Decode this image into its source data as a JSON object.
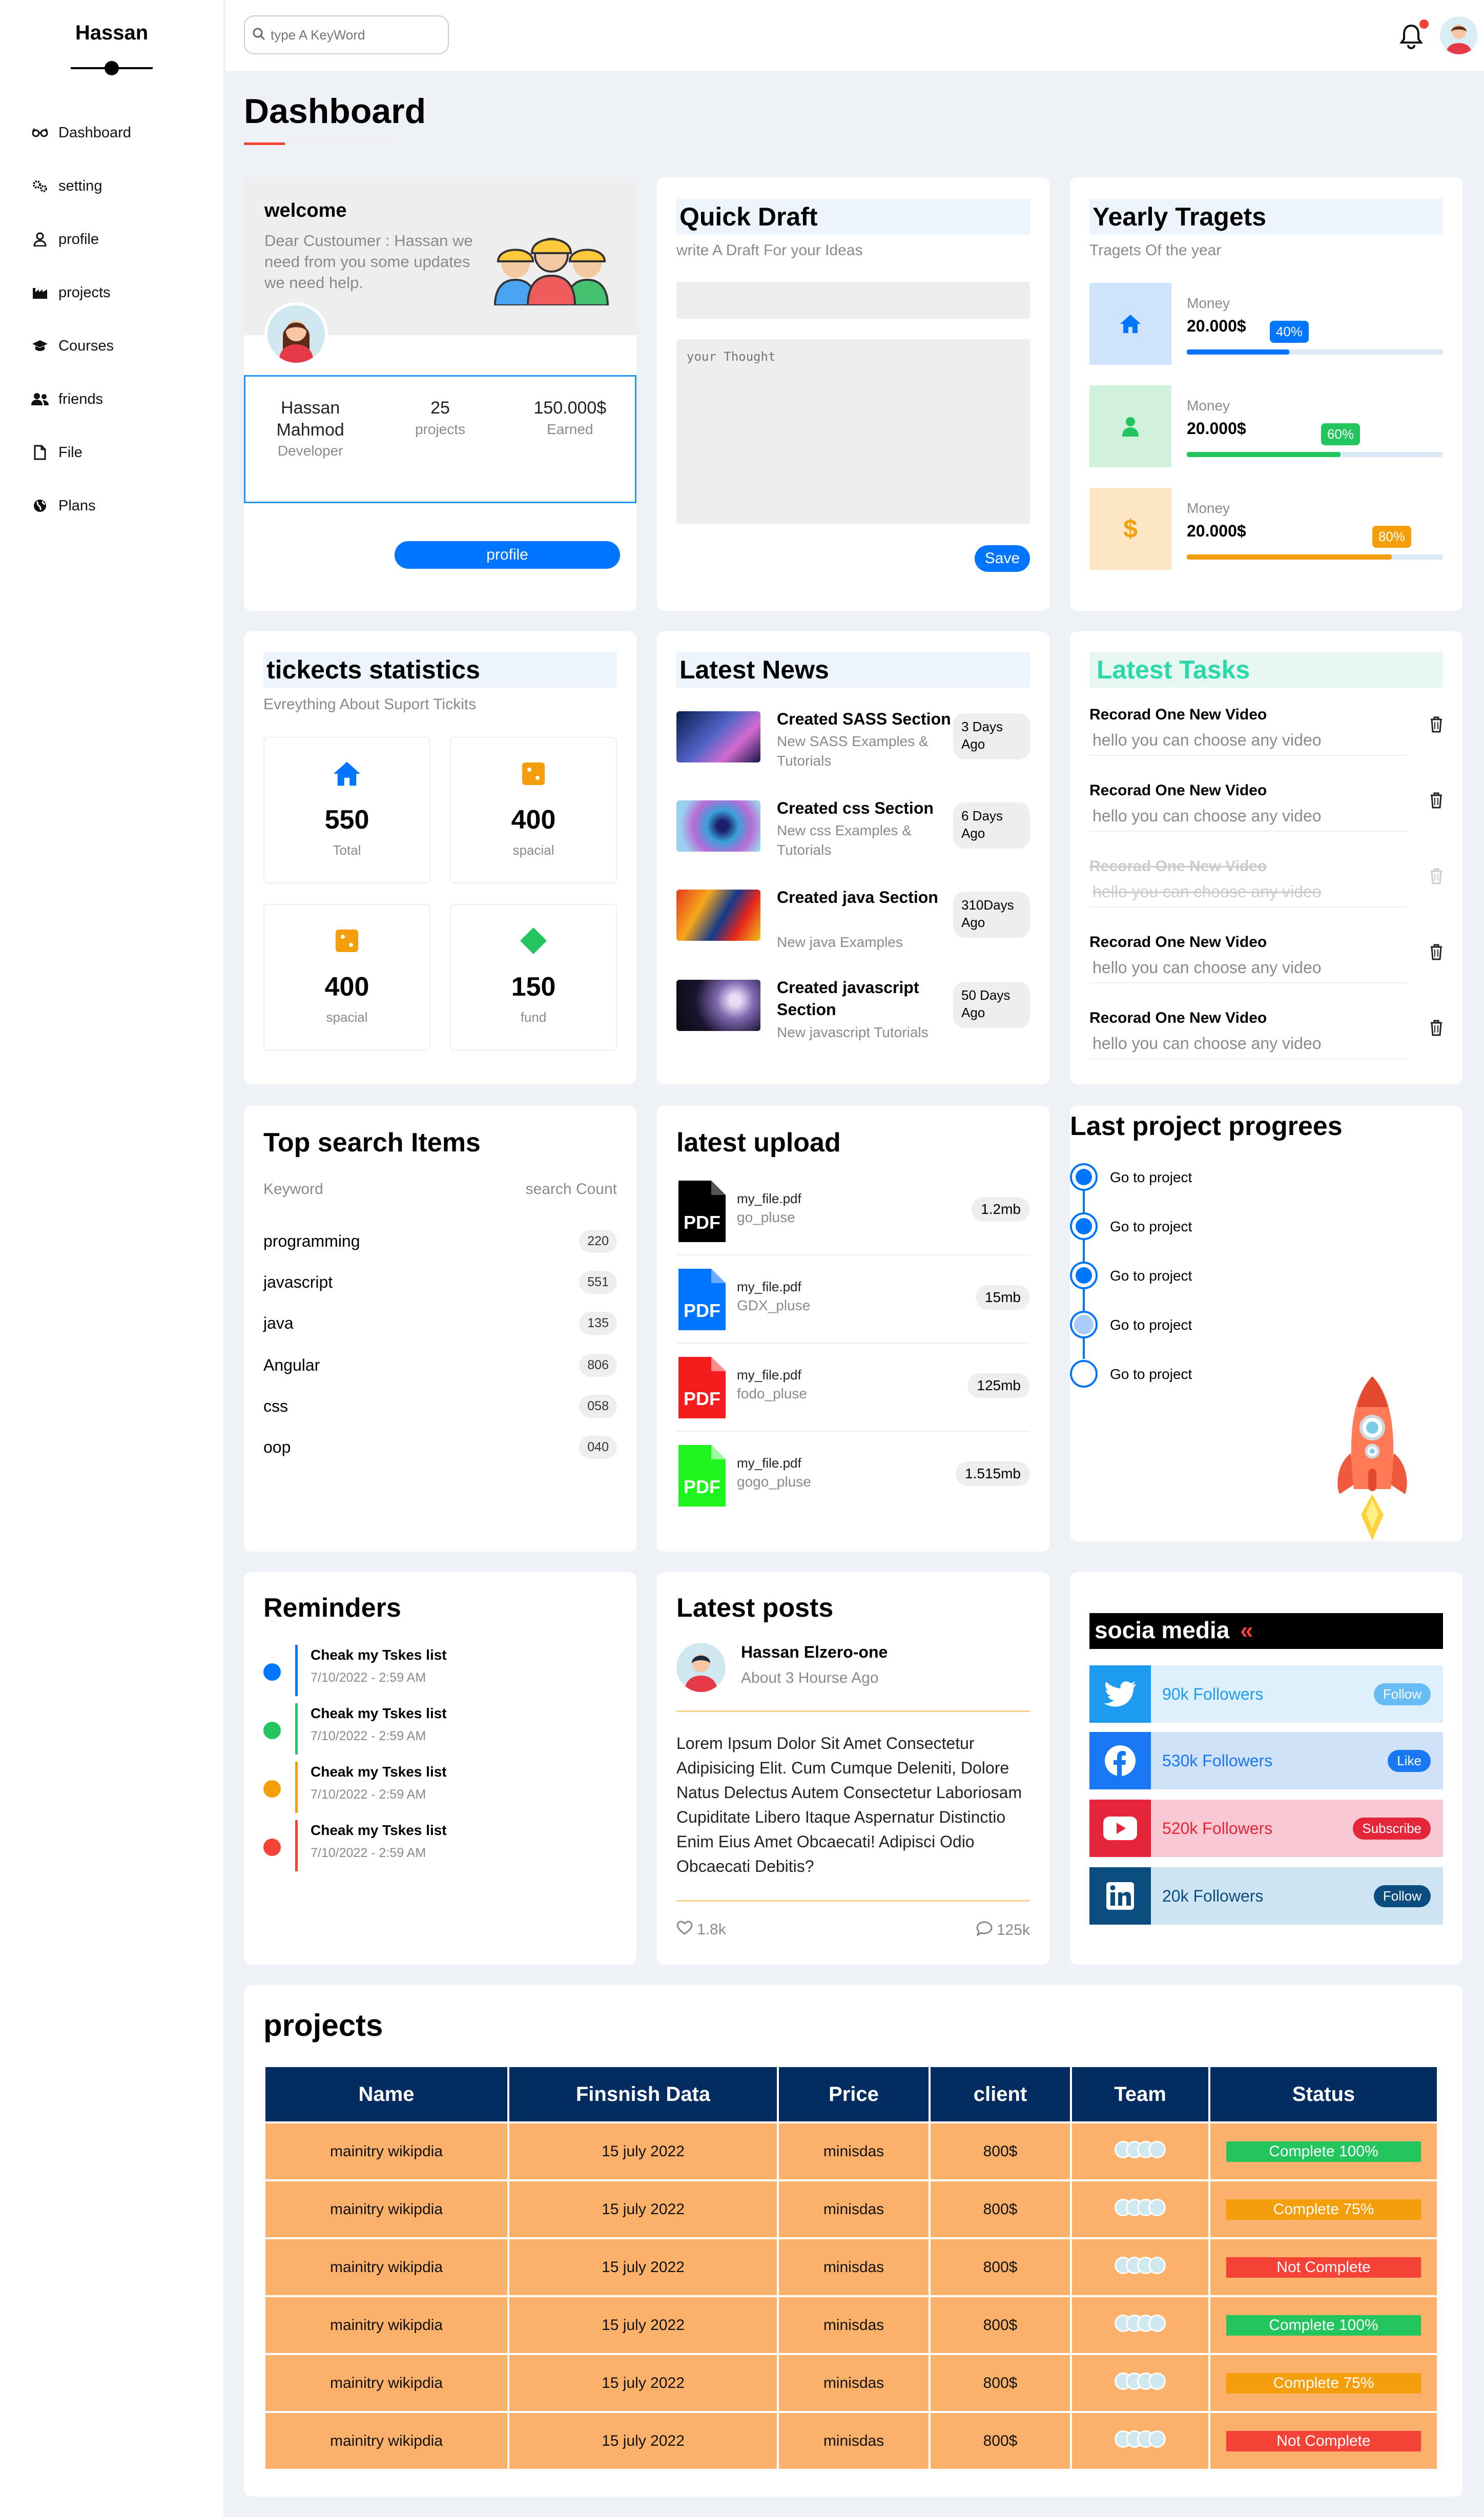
{
  "sidebar": {
    "brand": "Hassan",
    "items": [
      {
        "label": "Dashboard",
        "icon": "glasses-icon"
      },
      {
        "label": "setting",
        "icon": "gears-icon"
      },
      {
        "label": "profile",
        "icon": "user-icon"
      },
      {
        "label": "projects",
        "icon": "industry-icon"
      },
      {
        "label": "Courses",
        "icon": "graduation-cap-icon"
      },
      {
        "label": "friends",
        "icon": "users-icon"
      },
      {
        "label": "File",
        "icon": "file-icon"
      },
      {
        "label": "Plans",
        "icon": "globe-icon"
      }
    ]
  },
  "header": {
    "search_placeholder": "type A KeyWord"
  },
  "page_title": "Dashboard",
  "welcome": {
    "title": "welcome",
    "text": "Dear Custoumer : Hassan we need from you some updates we need help.",
    "stats": [
      {
        "value": "Hassan Mahmod",
        "label": "Developer"
      },
      {
        "value": "25",
        "label": "projects"
      },
      {
        "value": "150.000$",
        "label": "Earned"
      }
    ],
    "button": "profile"
  },
  "quick_draft": {
    "title": "Quick Draft",
    "subtitle": "write A Draft For your Ideas",
    "textarea_placeholder": "your Thought",
    "save": "Save"
  },
  "targets": {
    "title": "Yearly Tragets",
    "subtitle": "Tragets Of the year",
    "items": [
      {
        "label": "Money",
        "value": "20.000$",
        "percent": 40,
        "percent_label": "40%",
        "color": "#0075ff",
        "bg": "#cfe3fb",
        "icon": "home-icon"
      },
      {
        "label": "Money",
        "value": "20.000$",
        "percent": 60,
        "percent_label": "60%",
        "color": "#22c55e",
        "bg": "#d1f1dd",
        "icon": "user-icon"
      },
      {
        "label": "Money",
        "value": "20.000$",
        "percent": 80,
        "percent_label": "80%",
        "color": "#f59e0b",
        "bg": "#fde6c3",
        "icon": "dollar-icon"
      }
    ]
  },
  "tickets": {
    "title": "tickects statistics",
    "subtitle": "Evreything About Suport Tickits",
    "items": [
      {
        "number": "550",
        "label": "Total",
        "icon": "home-icon"
      },
      {
        "number": "400",
        "label": "spacial",
        "icon": "square-orange-icon"
      },
      {
        "number": "400",
        "label": "spacial",
        "icon": "square-orange-icon"
      },
      {
        "number": "150",
        "label": "fund",
        "icon": "diamond-green-icon"
      }
    ]
  },
  "news": {
    "title": "Latest News",
    "items": [
      {
        "title": "Created SASS Section",
        "desc": "New SASS Examples & Tutorials",
        "ago": "3 Days Ago"
      },
      {
        "title": "Created css Section",
        "desc": "New css Examples & Tutorials",
        "ago": "6 Days Ago"
      },
      {
        "title": "Created java Section",
        "desc": "New java Examples",
        "ago": "310Days Ago"
      },
      {
        "title": "Created javascript Section",
        "desc": "New javascript Tutorials",
        "ago": "50 Days Ago"
      }
    ]
  },
  "tasks": {
    "title": "Latest Tasks",
    "items": [
      {
        "title": "Recorad One New Video",
        "desc": "hello you can choose any video",
        "done": false
      },
      {
        "title": "Recorad One New Video",
        "desc": "hello you can choose any video",
        "done": false
      },
      {
        "title": "Recorad One New Video",
        "desc": "hello you can choose any video",
        "done": true
      },
      {
        "title": "Recorad One New Video",
        "desc": "hello you can choose any video",
        "done": false
      },
      {
        "title": "Recorad One New Video",
        "desc": "hello you can choose any video",
        "done": false
      }
    ]
  },
  "top_search": {
    "title": "Top search Items",
    "col_keyword": "Keyword",
    "col_count": "search Count",
    "items": [
      {
        "keyword": "programming",
        "count": "220"
      },
      {
        "keyword": "javascript",
        "count": "551"
      },
      {
        "keyword": "java",
        "count": "135"
      },
      {
        "keyword": "Angular",
        "count": "806"
      },
      {
        "keyword": "css",
        "count": "058"
      },
      {
        "keyword": "oop",
        "count": "040"
      }
    ]
  },
  "uploads": {
    "title": "latest upload",
    "items": [
      {
        "name": "my_file.pdf",
        "owner": "go_pluse",
        "size": "1.2mb",
        "color": "#000000"
      },
      {
        "name": "my_file.pdf",
        "owner": "GDX_pluse",
        "size": "15mb",
        "color": "#0075ff"
      },
      {
        "name": "my_file.pdf",
        "owner": "fodo_pluse",
        "size": "125mb",
        "color": "#f41c1c"
      },
      {
        "name": "my_file.pdf",
        "owner": "gogo_pluse",
        "size": "1.515mb",
        "color": "#1cf41c"
      }
    ]
  },
  "progress": {
    "title": "Last project progrees",
    "steps": [
      {
        "label": "Go to project",
        "state": "full"
      },
      {
        "label": "Go to project",
        "state": "full"
      },
      {
        "label": "Go to project",
        "state": "full"
      },
      {
        "label": "Go to project",
        "state": "half"
      },
      {
        "label": "Go to project",
        "state": "empty"
      }
    ]
  },
  "reminders": {
    "title": "Reminders",
    "items": [
      {
        "title": "Cheak my Tskes list",
        "time": "7/10/2022 - 2:59 AM",
        "color": "#0075ff"
      },
      {
        "title": "Cheak my Tskes list",
        "time": "7/10/2022 - 2:59 AM",
        "color": "#22c55e"
      },
      {
        "title": "Cheak my Tskes list",
        "time": "7/10/2022 - 2:59 AM",
        "color": "#f59e0b"
      },
      {
        "title": "Cheak my Tskes list",
        "time": "7/10/2022 - 2:59 AM",
        "color": "#f44336"
      }
    ]
  },
  "posts": {
    "title": "Latest posts",
    "author": "Hassan Elzero-one",
    "time": "About 3 Hourse Ago",
    "body": "Lorem Ipsum Dolor Sit Amet Consectetur Adipisicing Elit. Cum Cumque Deleniti, Dolore Natus Delectus Autem Consectetur Laboriosam Cupiditate Libero Itaque Aspernatur Distinctio Enim Eius Amet Obcaecati! Adipisci Odio Obcaecati Debitis?",
    "likes": "1.8k",
    "comments": "125k"
  },
  "social": {
    "title": "socia media",
    "title_mark": "«",
    "items": [
      {
        "followers": "90k Followers",
        "button": "Follow",
        "icon": "twitter-icon",
        "color": "#1d9bf0",
        "bg": "#def0fc",
        "text_color": "#1d9bf0"
      },
      {
        "followers": "530k Followers",
        "button": "Like",
        "icon": "facebook-icon",
        "color": "#1877f2",
        "bg": "#cfe2f8",
        "text_color": "#1877f2"
      },
      {
        "followers": "520k Followers",
        "button": "Subscribe",
        "icon": "youtube-icon",
        "color": "#e4253a",
        "bg": "#f8c9d2",
        "text_color": "#e4253a"
      },
      {
        "followers": "20k Followers",
        "button": "Follow",
        "icon": "linkedin-icon",
        "color": "#0b4d7e",
        "bg": "#cde4f3",
        "text_color": "#0b4d7e"
      }
    ]
  },
  "projects": {
    "title": "projects",
    "columns": [
      "Name",
      "Finsnish Data",
      "Price",
      "client",
      "Team",
      "Status"
    ],
    "rows": [
      {
        "name": "mainitry wikipdia",
        "date": "15 july 2022",
        "price": "minisdas",
        "client": "800$",
        "status": "Complete 100%",
        "status_color": "#22c55e"
      },
      {
        "name": "mainitry wikipdia",
        "date": "15 july 2022",
        "price": "minisdas",
        "client": "800$",
        "status": "Complete 75%",
        "status_color": "#f59e0b"
      },
      {
        "name": "mainitry wikipdia",
        "date": "15 july 2022",
        "price": "minisdas",
        "client": "800$",
        "status": "Not Complete",
        "status_color": "#f44336"
      },
      {
        "name": "mainitry wikipdia",
        "date": "15 july 2022",
        "price": "minisdas",
        "client": "800$",
        "status": "Complete 100%",
        "status_color": "#22c55e"
      },
      {
        "name": "mainitry wikipdia",
        "date": "15 july 2022",
        "price": "minisdas",
        "client": "800$",
        "status": "Complete 75%",
        "status_color": "#f59e0b"
      },
      {
        "name": "mainitry wikipdia",
        "date": "15 july 2022",
        "price": "minisdas",
        "client": "800$",
        "status": "Not Complete",
        "status_color": "#f44336"
      }
    ]
  }
}
